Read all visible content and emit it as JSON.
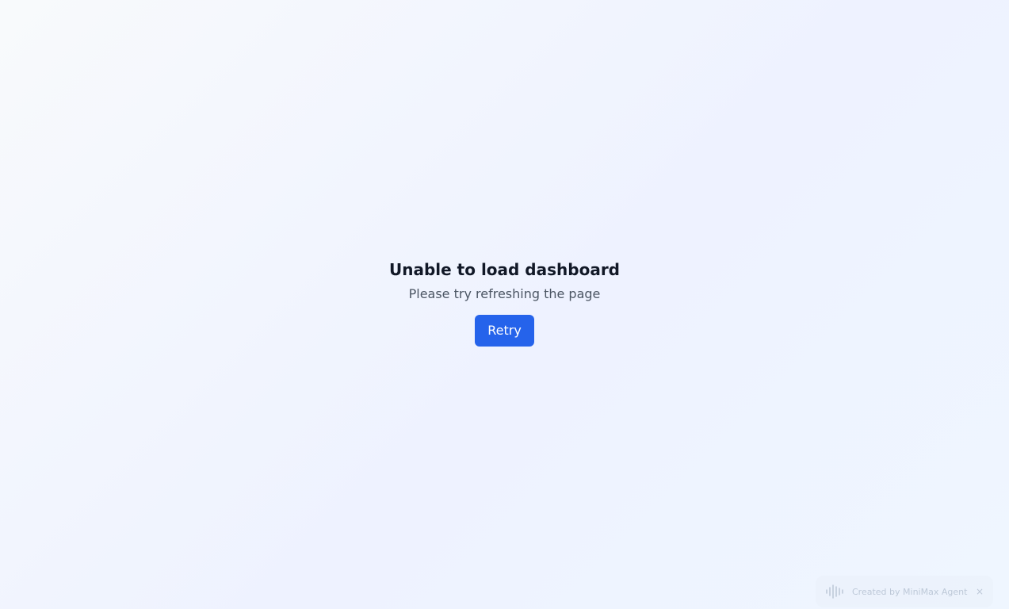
{
  "error": {
    "title": "Unable to load dashboard",
    "message": "Please try refreshing the page",
    "retry_label": "Retry"
  },
  "badge": {
    "label": "Created by MiniMax Agent",
    "icon": "waveform-icon",
    "close_symbol": "×"
  },
  "colors": {
    "accent": "#2563eb",
    "title": "#111827",
    "message": "#4b5563"
  }
}
